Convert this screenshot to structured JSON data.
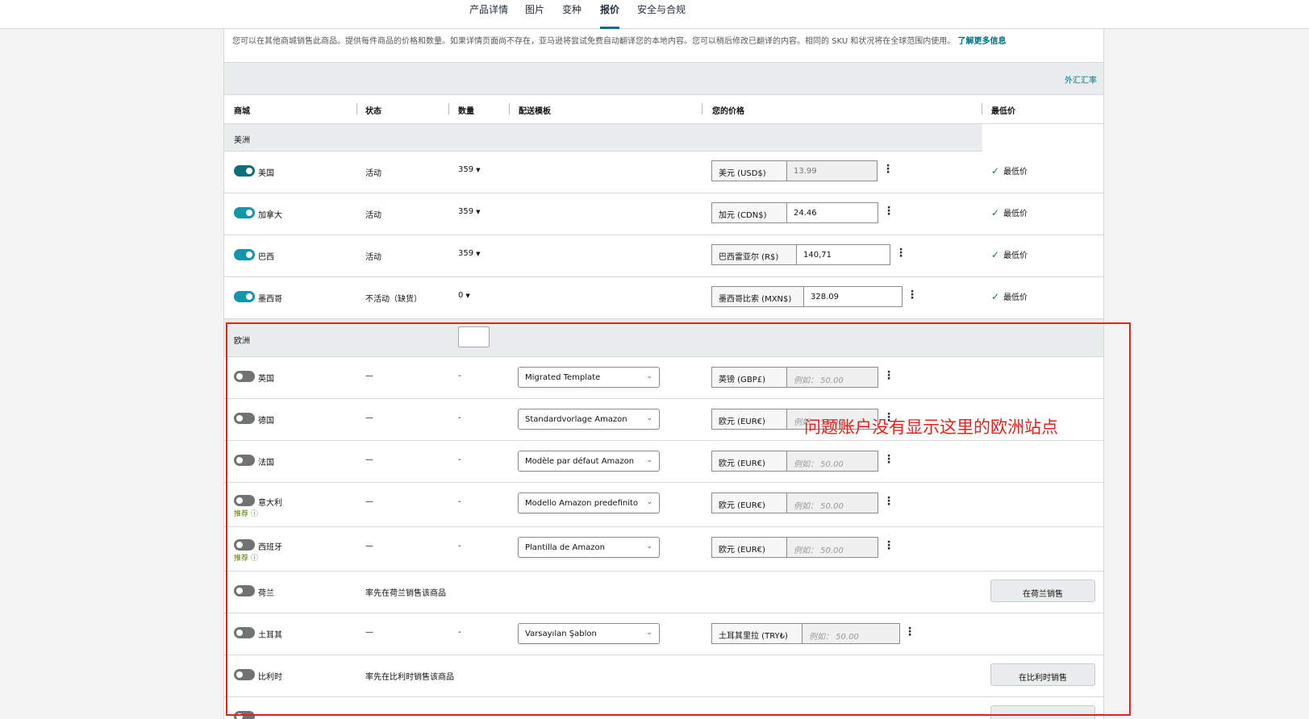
{
  "tabs": [
    "产品详情",
    "图片",
    "变种",
    "报价",
    "安全与合规"
  ],
  "intro": {
    "text": "您可以在其他商城销售此商品。提供每件商品的价格和数量。如果详情页面尚不存在，亚马逊将尝试免费自动翻译您的本地内容。您可以稍后修改已翻译的内容。相同的 SKU 和状况将在全球范围内使用。",
    "link": "了解更多信息"
  },
  "fx_link": "外汇汇率",
  "columns": [
    "商城",
    "状态",
    "数量",
    "配送模板",
    "您的价格",
    "最低价"
  ],
  "regions": {
    "americas": "美洲",
    "europe": "欧洲"
  },
  "americas_rows": [
    {
      "market": "美国",
      "status": "活动",
      "qty": "359",
      "currency": "美元 (USD$)",
      "price": "13.99",
      "lowest": "最低价"
    },
    {
      "market": "加拿大",
      "status": "活动",
      "qty": "359",
      "currency": "加元 (CDN$)",
      "price": "24.46",
      "lowest": "最低价"
    },
    {
      "market": "巴西",
      "status": "活动",
      "qty": "359",
      "currency": "巴西雷亚尔 (R$)",
      "price": "140,71",
      "lowest": "最低价"
    },
    {
      "market": "墨西哥",
      "status": "不活动（缺货）",
      "qty": "0",
      "currency": "墨西哥比索 (MXN$)",
      "price": "328.09",
      "lowest": "最低价"
    }
  ],
  "europe_rows": [
    {
      "market": "英国",
      "status": "—",
      "qty": "-",
      "template": "Migrated Template",
      "currency": "英镑 (GBP£)",
      "placeholder": "例如： 50.00"
    },
    {
      "market": "德国",
      "status": "—",
      "qty": "-",
      "template": "Standardvorlage Amazon",
      "currency": "欧元 (EUR€)",
      "placeholder": "例如： 50.00"
    },
    {
      "market": "法国",
      "status": "—",
      "qty": "-",
      "template": "Modèle par défaut Amazon",
      "currency": "欧元 (EUR€)",
      "placeholder": "例如： 50.00"
    },
    {
      "market": "意大利",
      "status": "—",
      "qty": "-",
      "template": "Modello Amazon predefinito",
      "currency": "欧元 (EUR€)",
      "placeholder": "例如： 50.00",
      "reco": "推荐 ⓘ"
    },
    {
      "market": "西班牙",
      "status": "—",
      "qty": "-",
      "template": "Plantilla de Amazon",
      "currency": "欧元 (EUR€)",
      "placeholder": "例如： 50.00",
      "reco": "推荐 ⓘ"
    },
    {
      "market": "荷兰",
      "status": "率先在荷兰销售该商品",
      "button": "在荷兰销售"
    },
    {
      "market": "土耳其",
      "status": "—",
      "qty": "-",
      "template": "Varsayılan Şablon",
      "currency": "土耳其里拉 (TRY₺)",
      "placeholder": "例如： 50.00"
    },
    {
      "market": "比利时",
      "status": "率先在比利时销售该商品",
      "button": "在比利时销售"
    }
  ],
  "annotation": "问题账户没有显示这里的欧洲站点",
  "colors": {
    "accent": "#0f6d7c",
    "toggle_on": "#1396ab",
    "annotation": "#e0241c"
  }
}
